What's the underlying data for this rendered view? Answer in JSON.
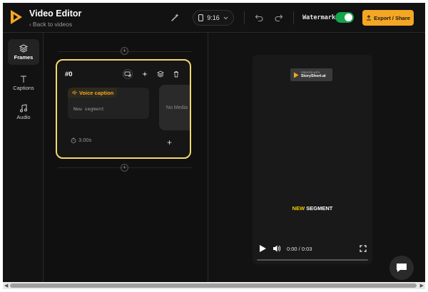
{
  "header": {
    "title": "Video Editor",
    "back_label": "Back to videos",
    "aspect_ratio": "9:16",
    "watermark_label": "Watermark",
    "watermark_on": true,
    "export_label": "Export / Share"
  },
  "sidebar": {
    "items": [
      {
        "label": "Frames",
        "icon": "layers-icon",
        "active": true
      },
      {
        "label": "Captions",
        "icon": "text-icon",
        "active": false
      },
      {
        "label": "Audio",
        "icon": "music-note-icon",
        "active": false
      }
    ]
  },
  "frame": {
    "number": "#0",
    "caption_label": "Voice caption",
    "caption_text": "New segment",
    "media_label": "No Media",
    "duration": "3.00s"
  },
  "preview": {
    "watermark_small": "CREATED WITH",
    "watermark_brand": "StoryShort.ai",
    "segment_highlight": "NEW",
    "segment_rest": " SEGMENT",
    "time": "0:00 / 0:03"
  },
  "colors": {
    "accent": "#f5a623",
    "frame_border": "#f5d76e",
    "toggle_on": "#16a34a",
    "background": "#101010"
  }
}
